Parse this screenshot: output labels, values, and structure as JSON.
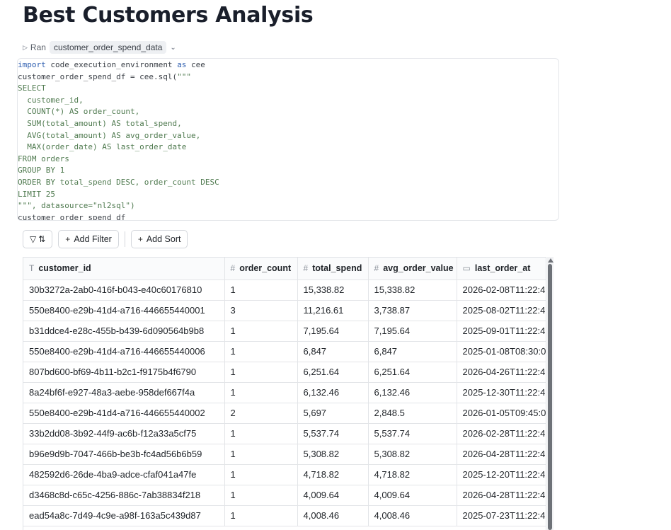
{
  "page": {
    "title": "Best Customers Analysis"
  },
  "run": {
    "label": "Ran",
    "dataset": "customer_order_spend_data"
  },
  "code": {
    "lines": [
      [
        [
          "kw",
          "import"
        ],
        [
          "plain",
          " code_execution_environment "
        ],
        [
          "kw",
          "as"
        ],
        [
          "plain",
          " cee"
        ]
      ],
      [
        [
          "plain",
          "customer_order_spend_df = cee.sql("
        ],
        [
          "str",
          "\"\"\""
        ]
      ],
      [
        [
          "str",
          "SELECT"
        ]
      ],
      [
        [
          "str",
          "  customer_id,"
        ]
      ],
      [
        [
          "str",
          "  COUNT(*) AS order_count,"
        ]
      ],
      [
        [
          "str",
          "  SUM(total_amount) AS total_spend,"
        ]
      ],
      [
        [
          "str",
          "  AVG(total_amount) AS avg_order_value,"
        ]
      ],
      [
        [
          "str",
          "  MAX(order_date) AS last_order_date"
        ]
      ],
      [
        [
          "str",
          "FROM orders"
        ]
      ],
      [
        [
          "str",
          "GROUP BY 1"
        ]
      ],
      [
        [
          "str",
          "ORDER BY total_spend DESC, order_count DESC"
        ]
      ],
      [
        [
          "str",
          "LIMIT 25"
        ]
      ],
      [
        [
          "str",
          "\"\"\", datasource=\"nl2sql\")"
        ]
      ],
      [
        [
          "plain",
          "customer_order_spend_df"
        ]
      ]
    ]
  },
  "toolbar": {
    "filter_sort_icon": "filter-sort-icon",
    "add_filter_label": "Add Filter",
    "add_sort_label": "Add Sort"
  },
  "table": {
    "columns": [
      {
        "icon": "text-type-icon",
        "glyph": "T",
        "label": "customer_id",
        "width": 284
      },
      {
        "icon": "number-type-icon",
        "glyph": "#",
        "label": "order_count",
        "width": 103
      },
      {
        "icon": "number-type-icon",
        "glyph": "#",
        "label": "total_spend",
        "width": 100
      },
      {
        "icon": "number-type-icon",
        "glyph": "#",
        "label": "avg_order_value",
        "width": 125
      },
      {
        "icon": "calendar-icon",
        "glyph": "▭",
        "label": "last_order_at",
        "width": 140
      }
    ],
    "rows": [
      [
        "30b3272a-2ab0-416f-b043-e40c60176810",
        "1",
        "15,338.82",
        "15,338.82",
        "2026-02-08T11:22:4"
      ],
      [
        "550e8400-e29b-41d4-a716-446655440001",
        "3",
        "11,216.61",
        "3,738.87",
        "2025-08-02T11:22:4"
      ],
      [
        "b31ddce4-e28c-455b-b439-6d090564b9b8",
        "1",
        "7,195.64",
        "7,195.64",
        "2025-09-01T11:22:4"
      ],
      [
        "550e8400-e29b-41d4-a716-446655440006",
        "1",
        "6,847",
        "6,847",
        "2025-01-08T08:30:0"
      ],
      [
        "807bd600-bf69-4b11-b2c1-f9175b4f6790",
        "1",
        "6,251.64",
        "6,251.64",
        "2026-04-26T11:22:4"
      ],
      [
        "8a24bf6f-e927-48a3-aebe-958def667f4a",
        "1",
        "6,132.46",
        "6,132.46",
        "2025-12-30T11:22:4"
      ],
      [
        "550e8400-e29b-41d4-a716-446655440002",
        "2",
        "5,697",
        "2,848.5",
        "2026-01-05T09:45:0"
      ],
      [
        "33b2dd08-3b92-44f9-ac6b-f12a33a5cf75",
        "1",
        "5,537.74",
        "5,537.74",
        "2026-02-28T11:22:4"
      ],
      [
        "b96e9d9b-7047-466b-be3b-fc4ad56b6b59",
        "1",
        "5,308.82",
        "5,308.82",
        "2026-04-28T11:22:4"
      ],
      [
        "482592d6-26de-4ba9-adce-cfaf041a47fe",
        "1",
        "4,718.82",
        "4,718.82",
        "2025-12-20T11:22:4"
      ],
      [
        "d3468c8d-c65c-4256-886c-7ab38834f218",
        "1",
        "4,009.64",
        "4,009.64",
        "2026-04-28T11:22:4"
      ],
      [
        "ead54a8c-7d49-4c9e-a98f-163a5c439d87",
        "1",
        "4,008.46",
        "4,008.46",
        "2025-07-23T11:22:4"
      ]
    ]
  }
}
